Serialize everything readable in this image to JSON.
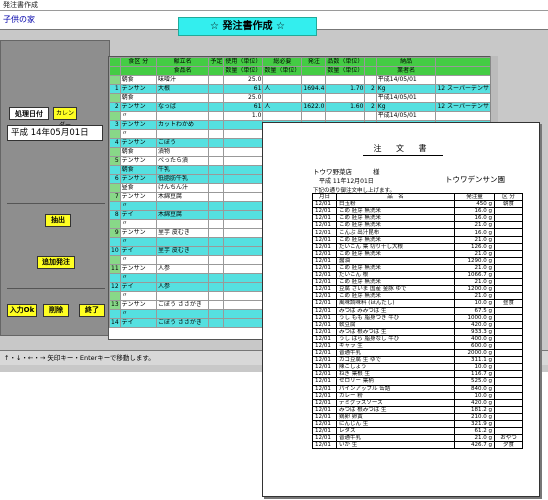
{
  "window": {
    "title": "発注書作成",
    "org": "子供の家",
    "banner": "☆ 発注書作成 ☆"
  },
  "left": {
    "date_label": "処理日付",
    "calendar_button": "カレンダー",
    "date_value": "平成 14年05月01日",
    "extract_button": "抽出",
    "add_order_button": "追加発注",
    "ok_button": "入力Ok",
    "delete_button": "削除",
    "end_button": "終了"
  },
  "status_text": "↑・↓・←・→ 矢印キー・Enterキーで移動します。",
  "grid": {
    "headers_top": [
      "",
      "食区 分",
      "献立名",
      "予定",
      "使用（単位）",
      "総必要",
      "発注",
      "品数（単位）",
      "",
      "納品",
      ""
    ],
    "headers_bottom": [
      "",
      "",
      "食品名",
      "",
      "数量（単位）",
      "数量（単位）",
      "",
      "数量（単位）",
      "",
      "業者名",
      ""
    ],
    "rows": [
      {
        "idx": "",
        "a": "朝食",
        "b": "味噌汁",
        "c": "",
        "d": "25.0",
        "e": "",
        "f": "",
        "g": "",
        "h": "",
        "i": "平成14/05/01",
        "j": "",
        "cyan": false
      },
      {
        "idx": "1",
        "a": "デンサン",
        "b": "大根",
        "c": "",
        "d": "61",
        "e": "人",
        "f": "1694.4",
        "g": "1.70",
        "h": "2",
        "i": "Kg",
        "j": "12 スーパーデンサン",
        "k": "12",
        "cyan": true
      },
      {
        "idx": "",
        "a": "朝食",
        "b": "",
        "c": "",
        "d": "25.0",
        "e": "",
        "f": "",
        "g": "",
        "h": "",
        "i": "平成14/05/01",
        "j": "",
        "cyan": false
      },
      {
        "idx": "2",
        "a": "デンサン",
        "b": "なっぱ",
        "c": "",
        "d": "61",
        "e": "人",
        "f": "1622.0",
        "g": "1.60",
        "h": "2",
        "i": "Kg",
        "j": "12 スーパーデンサン",
        "k": "12",
        "cyan": true
      },
      {
        "idx": "",
        "a": "〃",
        "b": "",
        "c": "",
        "d": "1.0",
        "e": "",
        "f": "",
        "g": "",
        "h": "",
        "i": "平成14/05/01",
        "j": "",
        "cyan": false
      },
      {
        "idx": "3",
        "a": "デンサン",
        "b": "カットわかめ",
        "c": "",
        "d": "",
        "e": "",
        "f": "",
        "g": "",
        "h": "",
        "i": "",
        "j": "",
        "k": "",
        "cyan": true
      },
      {
        "idx": "",
        "a": "〃",
        "b": "",
        "c": "",
        "d": "",
        "e": "",
        "f": "",
        "g": "",
        "h": "",
        "i": "",
        "j": "",
        "cyan": false
      },
      {
        "idx": "4",
        "a": "デンサン",
        "b": "ごぼう",
        "c": "",
        "d": "",
        "e": "",
        "f": "",
        "g": "",
        "h": "",
        "i": "",
        "j": "",
        "k": "",
        "cyan": true
      },
      {
        "idx": "",
        "a": "朝食",
        "b": "漬物",
        "c": "",
        "d": "",
        "e": "",
        "f": "",
        "g": "",
        "h": "",
        "i": "",
        "j": "",
        "cyan": false
      },
      {
        "idx": "5",
        "a": "デンサン",
        "b": "べったら漬",
        "c": "",
        "d": "",
        "e": "",
        "f": "",
        "g": "",
        "h": "",
        "i": "",
        "j": "",
        "k": "",
        "cyan": false
      },
      {
        "idx": "",
        "a": "朝食",
        "b": "牛乳",
        "c": "",
        "d": "",
        "e": "",
        "f": "",
        "g": "",
        "h": "",
        "i": "",
        "j": "",
        "cyan": true
      },
      {
        "idx": "6",
        "a": "デンサン",
        "b": "低脂肪牛乳",
        "c": "",
        "d": "",
        "e": "",
        "f": "",
        "g": "",
        "h": "",
        "i": "",
        "j": "",
        "k": "",
        "cyan": true
      },
      {
        "idx": "",
        "a": "昼食",
        "b": "けんちん汁",
        "c": "",
        "d": "",
        "e": "",
        "f": "",
        "g": "",
        "h": "",
        "i": "",
        "j": "",
        "cyan": false
      },
      {
        "idx": "7",
        "a": "デンサン",
        "b": "木綿豆腐",
        "c": "",
        "d": "",
        "e": "",
        "f": "",
        "g": "",
        "h": "",
        "i": "",
        "j": "",
        "k": "",
        "cyan": false
      },
      {
        "idx": "",
        "a": "〃",
        "b": "",
        "c": "",
        "d": "",
        "e": "",
        "f": "",
        "g": "",
        "h": "",
        "i": "",
        "j": "",
        "cyan": true
      },
      {
        "idx": "8",
        "a": "デイ",
        "b": "木綿豆腐",
        "c": "",
        "d": "",
        "e": "",
        "f": "",
        "g": "",
        "h": "",
        "i": "",
        "j": "",
        "k": "",
        "cyan": true
      },
      {
        "idx": "",
        "a": "〃",
        "b": "",
        "c": "",
        "d": "",
        "e": "",
        "f": "",
        "g": "",
        "h": "",
        "i": "",
        "j": "",
        "cyan": false
      },
      {
        "idx": "9",
        "a": "デンサン",
        "b": "里芋 皮むき",
        "c": "",
        "d": "",
        "e": "",
        "f": "",
        "g": "",
        "h": "",
        "i": "",
        "j": "",
        "k": "",
        "cyan": false
      },
      {
        "idx": "",
        "a": "〃",
        "b": "",
        "c": "",
        "d": "",
        "e": "",
        "f": "",
        "g": "",
        "h": "",
        "i": "",
        "j": "",
        "cyan": true
      },
      {
        "idx": "10",
        "a": "デイ",
        "b": "里芋 皮むき",
        "c": "",
        "d": "",
        "e": "",
        "f": "",
        "g": "",
        "h": "",
        "i": "",
        "j": "",
        "k": "",
        "cyan": true
      },
      {
        "idx": "",
        "a": "〃",
        "b": "",
        "c": "",
        "d": "",
        "e": "",
        "f": "",
        "g": "",
        "h": "",
        "i": "",
        "j": "",
        "cyan": false
      },
      {
        "idx": "11",
        "a": "デンサン",
        "b": "人参",
        "c": "",
        "d": "",
        "e": "",
        "f": "",
        "g": "",
        "h": "",
        "i": "",
        "j": "",
        "k": "",
        "cyan": false
      },
      {
        "idx": "",
        "a": "〃",
        "b": "",
        "c": "",
        "d": "",
        "e": "",
        "f": "",
        "g": "",
        "h": "",
        "i": "",
        "j": "",
        "cyan": true
      },
      {
        "idx": "12",
        "a": "デイ",
        "b": "人参",
        "c": "",
        "d": "",
        "e": "",
        "f": "",
        "g": "",
        "h": "",
        "i": "",
        "j": "",
        "k": "",
        "cyan": true
      },
      {
        "idx": "",
        "a": "〃",
        "b": "",
        "c": "",
        "d": "",
        "e": "",
        "f": "",
        "g": "",
        "h": "",
        "i": "",
        "j": "",
        "cyan": false
      },
      {
        "idx": "13",
        "a": "デンサン",
        "b": "ごぼう ささがき",
        "c": "",
        "d": "",
        "e": "",
        "f": "",
        "g": "",
        "h": "",
        "i": "",
        "j": "",
        "k": "",
        "cyan": false
      },
      {
        "idx": "",
        "a": "〃",
        "b": "",
        "c": "",
        "d": "",
        "e": "",
        "f": "",
        "g": "",
        "h": "",
        "i": "",
        "j": "",
        "cyan": true
      },
      {
        "idx": "14",
        "a": "デイ",
        "b": "ごぼう ささがき",
        "c": "",
        "d": "",
        "e": "",
        "f": "",
        "g": "",
        "h": "",
        "i": "",
        "j": "",
        "k": "",
        "cyan": true
      }
    ]
  },
  "document": {
    "title": "注 文 書",
    "vendor": "トウワ野菜店",
    "honorific": "様",
    "date": "平成  11年12月01日",
    "sender": "トウワデンサン園",
    "note": "下記の通り御注文申し上げます。",
    "headers": [
      "月日",
      "品　名",
      "発注量",
      "区 分"
    ],
    "rows": [
      [
        "12/01",
        "白玉粉",
        "450 g",
        "朝食"
      ],
      [
        "12/01",
        "こめ 胚芽 無洗米",
        "16.0 g",
        ""
      ],
      [
        "12/01",
        "こめ 胚芽 無洗米",
        "16.0 g",
        ""
      ],
      [
        "12/01",
        "こめ 胚芽 無洗米",
        "21.0 g",
        ""
      ],
      [
        "12/01",
        "こんぶ 出汁昆布",
        "16.0 g",
        ""
      ],
      [
        "12/01",
        "こめ 胚芽 無洗米",
        "21.0 g",
        ""
      ],
      [
        "12/01",
        "だいこん 葉 切り干し大根",
        "126.0 g",
        ""
      ],
      [
        "12/01",
        "こめ 胚芽 無洗米",
        "21.0 g",
        ""
      ],
      [
        "12/01",
        "醤油",
        "1290.0 g",
        ""
      ],
      [
        "12/01",
        "こめ 胚芽 無洗米",
        "21.0 g",
        ""
      ],
      [
        "12/01",
        "だいこん 根",
        "1066.7 g",
        ""
      ],
      [
        "12/01",
        "こめ 胚芽 無洗米",
        "21.0 g",
        ""
      ],
      [
        "12/01",
        "豆腐 さいま 国産 金豚 ゆで",
        "1200.0 g",
        ""
      ],
      [
        "12/01",
        "こめ 胚芽 無洗米",
        "21.0 g",
        ""
      ],
      [
        "12/01",
        "風味調味料 (ほんだし)",
        "10.0 g",
        "昼食"
      ],
      [
        "12/01",
        "みつば みみつば 生",
        "67.5 g",
        ""
      ],
      [
        "12/01",
        "うし もも 脂身つき 牛ひ",
        "1000.0 g",
        ""
      ],
      [
        "12/01",
        "軟豆腐",
        "420.0 g",
        ""
      ],
      [
        "12/01",
        "みつば 根みつば 生",
        "933.3 g",
        ""
      ],
      [
        "12/01",
        "うし ばら 脂身なし 牛ひ",
        "400.0 g",
        ""
      ],
      [
        "12/01",
        "キャラ 生",
        "600.0 g",
        ""
      ],
      [
        "12/01",
        "普通牛乳",
        "2000.0 g",
        ""
      ],
      [
        "12/01",
        "カゴ豆腐 生 ゆで",
        "311.1 g",
        ""
      ],
      [
        "12/01",
        "陳こしょう",
        "10.0 g",
        ""
      ],
      [
        "12/01",
        "ねぎ 葉根 生",
        "116.7 g",
        ""
      ],
      [
        "12/01",
        "セロリー 葉柄",
        "525.0 g",
        ""
      ],
      [
        "12/01",
        "パインアップル 缶詰",
        "840.0 g",
        ""
      ],
      [
        "12/01",
        "カレー 粉",
        "10.0 g",
        ""
      ],
      [
        "12/01",
        "デミグラスソース",
        "420.0 g",
        ""
      ],
      [
        "12/01",
        "みつば 根みつば 生",
        "181.2 g",
        ""
      ],
      [
        "12/01",
        "鶏卵 卵黄",
        "210.0 g",
        ""
      ],
      [
        "12/01",
        "にんじん 生",
        "321.9 g",
        ""
      ],
      [
        "12/01",
        "レタス",
        "61.2 g",
        ""
      ],
      [
        "12/01",
        "普通牛乳",
        "21.0 g",
        "おやつ"
      ],
      [
        "12/01",
        "いか 生",
        "426.7 g",
        "夕食"
      ]
    ]
  }
}
